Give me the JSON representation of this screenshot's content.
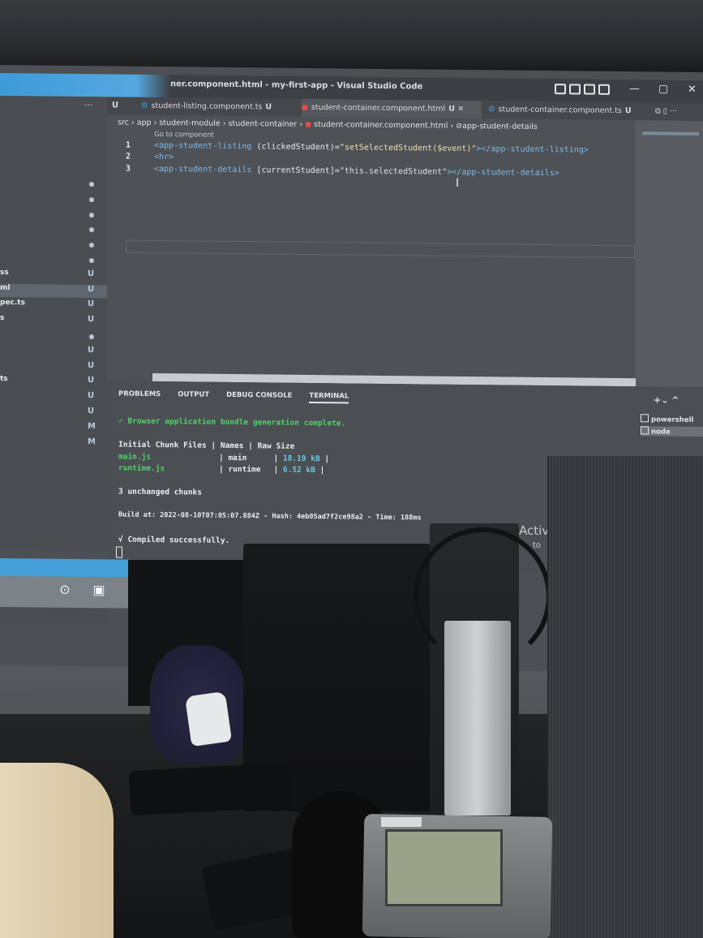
{
  "window": {
    "title": "ner.component.html - my-first-app - Visual Studio Code",
    "controls": {
      "minimize": "—",
      "maximize": "▢",
      "close": "✕"
    }
  },
  "sidebar": {
    "more": "···",
    "rows": [
      {
        "name": "",
        "status": "●"
      },
      {
        "name": "",
        "status": "●"
      },
      {
        "name": "",
        "status": "●"
      },
      {
        "name": "",
        "status": "●"
      },
      {
        "name": "",
        "status": "●"
      },
      {
        "name": "",
        "status": "●"
      },
      {
        "name": "ss",
        "status": "U"
      },
      {
        "name": "ml",
        "status": "U"
      },
      {
        "name": "pec.ts",
        "status": "U"
      },
      {
        "name": "s",
        "status": "U"
      },
      {
        "name": "",
        "status": "●"
      },
      {
        "name": "",
        "status": "U"
      },
      {
        "name": "",
        "status": "U"
      },
      {
        "name": "ts",
        "status": "U"
      },
      {
        "name": "",
        "status": "U"
      },
      {
        "name": "",
        "status": "U"
      },
      {
        "name": "",
        "status": "M"
      },
      {
        "name": "",
        "status": "M"
      }
    ]
  },
  "tabs": [
    {
      "label": "student-listing.component.ts",
      "mark": "U"
    },
    {
      "label": "student-container.component.html",
      "mark": "U ✕"
    },
    {
      "label": "student-container.component.ts",
      "mark": "U"
    }
  ],
  "breadcrumb": [
    "src",
    "app",
    "student-module",
    "student-container",
    "student-container.component.html",
    "app-student-details"
  ],
  "editor": {
    "codelens": "Go to component",
    "lines": [
      {
        "num": "1",
        "open": "<app-student-listing",
        "attr": " (clickedStudent)",
        "eq": "=",
        "val": "\"setSelectedStudent($event)\"",
        "close": "></app-student-listing>"
      },
      {
        "num": "2",
        "open": "<hr>",
        "attr": "",
        "eq": "",
        "val": "",
        "close": ""
      },
      {
        "num": "3",
        "open": "<app-student-details",
        "attr": " [currentStudent]",
        "eq": "=",
        "val": "\"this.selectedStudent\"",
        "close": "></app-student-details>"
      }
    ]
  },
  "panel": {
    "tabs": [
      "PROBLEMS",
      "OUTPUT",
      "DEBUG CONSOLE",
      "TERMINAL"
    ],
    "active_tab": "TERMINAL",
    "controls": "+⌄ ^",
    "terminals": [
      "powershell",
      "node"
    ],
    "output": {
      "bundle": "✓ Browser application bundle generation complete.",
      "header": "Initial Chunk Files | Names    | Raw Size",
      "rows": [
        {
          "file": "main.js",
          "name": "main",
          "size": "18.19 kB"
        },
        {
          "file": "runtime.js",
          "name": "runtime",
          "size": "6.52 kB"
        }
      ],
      "unchanged": "3 unchanged chunks",
      "build": "Build at: 2022-08-10T07:05:07.884Z - Hash: 4eb05ad7f2ce98a2 - Time: 188ms",
      "compiled": "√ Compiled successfully."
    }
  },
  "watermark": {
    "line1": "Activ",
    "line2": "to"
  },
  "taskbar": {
    "icons": [
      "record-icon",
      "store-icon"
    ]
  }
}
